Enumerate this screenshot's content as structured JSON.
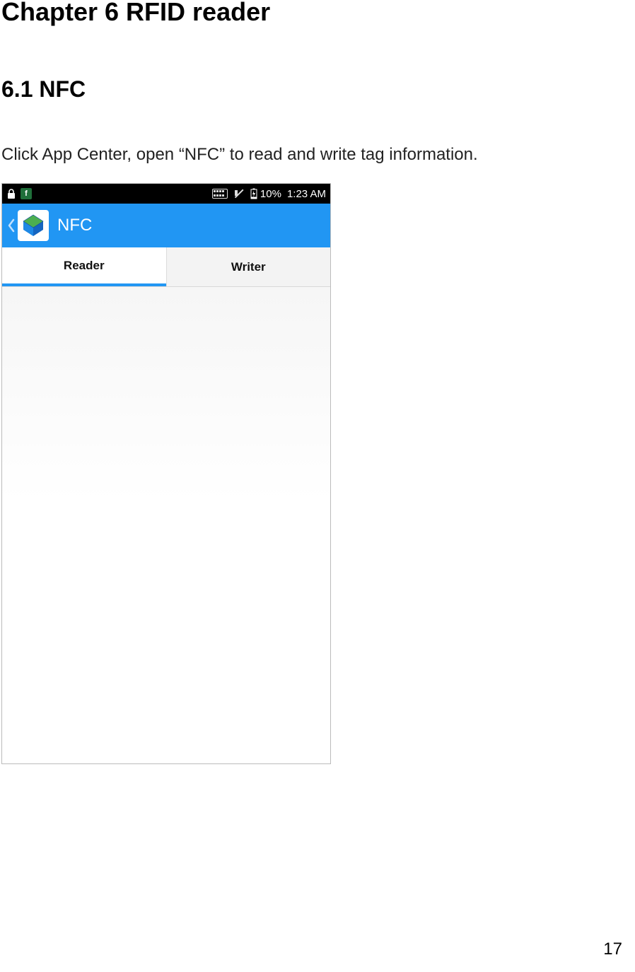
{
  "doc": {
    "chapter_title": "Chapter 6 RFID reader",
    "section_title": "6.1 NFC",
    "body_text": "Click App Center, open “NFC” to read and write tag information.",
    "page_number": "17"
  },
  "screenshot": {
    "statusbar": {
      "battery_pct": "10%",
      "time": "1:23 AM"
    },
    "header": {
      "app_title": "NFC"
    },
    "tabs": {
      "reader": "Reader",
      "writer": "Writer"
    }
  }
}
